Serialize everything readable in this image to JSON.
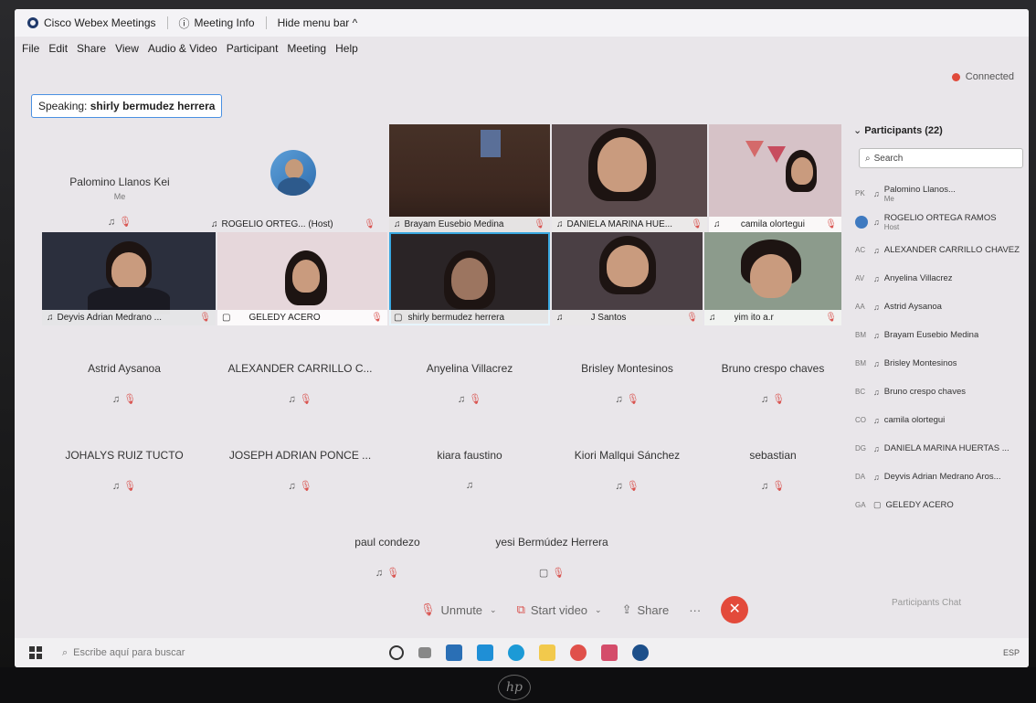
{
  "window": {
    "app_title": "Cisco Webex Meetings",
    "meeting_info": "Meeting Info",
    "hide_menu": "Hide menu bar ^"
  },
  "menu": [
    "File",
    "Edit",
    "Share",
    "View",
    "Audio & Video",
    "Participant",
    "Meeting",
    "Help"
  ],
  "status": {
    "connected": "Connected"
  },
  "speaking": {
    "label": "Speaking:",
    "name": "shirly bermudez herrera"
  },
  "tiles_row1": {
    "self_name": "Palomino Llanos Kei",
    "self_sub": "Me",
    "host_label": "ROGELIO ORTEG... (Host)",
    "t3": "Brayam Eusebio Medina",
    "t4": "DANIELA MARINA HUE...",
    "t5": "camila olortegui"
  },
  "tiles_row2": {
    "t1": "Deyvis Adrian Medrano ...",
    "t2": "GELEDY ACERO",
    "t3": "shirly bermudez herrera",
    "t4": "J Santos",
    "t5": "yim ito a.r"
  },
  "audio_tiles": [
    "Astrid Aysanoa",
    "ALEXANDER CARRILLO C...",
    "Anyelina Villacrez",
    "Brisley Montesinos",
    "Bruno crespo chaves",
    "JOHALYS RUIZ TUCTO",
    "JOSEPH ADRIAN PONCE ...",
    "kiara faustino",
    "Kiori Mallqui Sánchez",
    "sebastian",
    "paul condezo",
    "yesi Bermúdez Herrera"
  ],
  "toolbar": {
    "unmute": "Unmute",
    "start_video": "Start video",
    "share": "Share",
    "more": "···"
  },
  "panel": {
    "title": "Participants (22)",
    "search_placeholder": "Search",
    "participants": [
      {
        "initials": "PK",
        "name": "Palomino Llanos...",
        "role": "Me"
      },
      {
        "initials": "",
        "name": "ROGELIO ORTEGA RAMOS",
        "role": "Host"
      },
      {
        "initials": "AC",
        "name": "ALEXANDER CARRILLO CHAVEZ",
        "role": ""
      },
      {
        "initials": "AV",
        "name": "Anyelina Villacrez",
        "role": ""
      },
      {
        "initials": "AA",
        "name": "Astrid Aysanoa",
        "role": ""
      },
      {
        "initials": "BM",
        "name": "Brayam Eusebio Medina",
        "role": ""
      },
      {
        "initials": "BM",
        "name": "Brisley Montesinos",
        "role": ""
      },
      {
        "initials": "BC",
        "name": "Bruno crespo chaves",
        "role": ""
      },
      {
        "initials": "CO",
        "name": "camila olortegui",
        "role": ""
      },
      {
        "initials": "DG",
        "name": "DANIELA MARINA HUERTAS ...",
        "role": ""
      },
      {
        "initials": "DA",
        "name": "Deyvis Adrian Medrano Aros...",
        "role": ""
      },
      {
        "initials": "GA",
        "name": "GELEDY ACERO",
        "role": ""
      }
    ],
    "footer": "Participants   Chat"
  },
  "taskbar": {
    "search_placeholder": "Escribe aquí para buscar",
    "tray": "ESP"
  }
}
